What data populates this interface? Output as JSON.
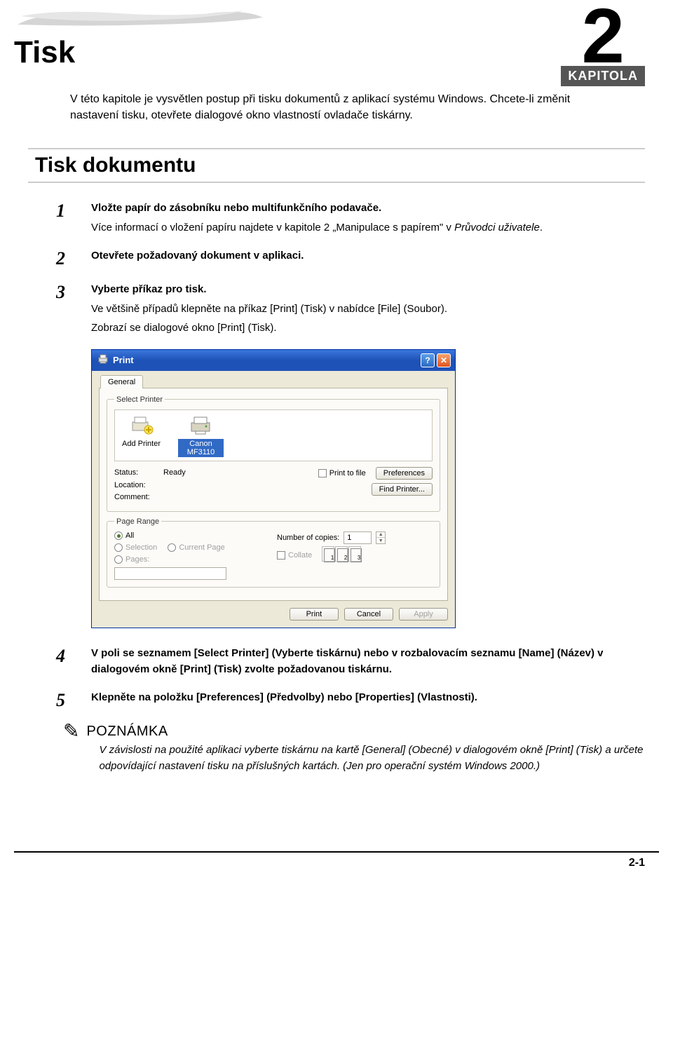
{
  "chapter": {
    "number": "2",
    "label": "KAPITOLA"
  },
  "title": "Tisk",
  "intro": "V této kapitole je vysvětlen postup při tisku dokumentů z aplikací systému Windows. Chcete-li změnit nastavení tisku, otevřete dialogové okno vlastností ovladače tiskárny.",
  "section_heading": "Tisk dokumentu",
  "steps": [
    {
      "num": "1",
      "bold": "Vložte papír do zásobníku nebo multifunkčního podavače.",
      "second_pre": "Více informací o vložení papíru najdete v kapitole 2 „Manipulace s papírem\" v ",
      "second_em": "Průvodci uživatele",
      "second_post": "."
    },
    {
      "num": "2",
      "bold": "Otevřete požadovaný dokument v aplikaci."
    },
    {
      "num": "3",
      "bold": "Vyberte příkaz pro tisk.",
      "second": "Ve většině případů klepněte na příkaz [Print] (Tisk) v nabídce [File] (Soubor).",
      "third": "Zobrazí se dialogové okno [Print] (Tisk)."
    },
    {
      "num": "4",
      "bold": "V poli se seznamem [Select Printer] (Vyberte tiskárnu) nebo v rozbalovacím seznamu [Name] (Název) v dialogovém okně [Print] (Tisk) zvolte požadovanou tiskárnu."
    },
    {
      "num": "5",
      "bold": "Klepněte na položku [Preferences] (Předvolby) nebo [Properties] (Vlastnosti)."
    }
  ],
  "dialog": {
    "title": "Print",
    "tab": "General",
    "group_select": "Select Printer",
    "printers": {
      "add": "Add Printer",
      "selected": "Canon MF3110"
    },
    "status": {
      "status_lbl": "Status:",
      "status_val": "Ready",
      "location_lbl": "Location:",
      "comment_lbl": "Comment:",
      "print_to_file": "Print to file",
      "preferences": "Preferences",
      "find_printer": "Find Printer..."
    },
    "range": {
      "legend": "Page Range",
      "all": "All",
      "selection": "Selection",
      "current": "Current Page",
      "pages": "Pages:",
      "copies_lbl": "Number of copies:",
      "copies_val": "1",
      "collate": "Collate",
      "p1": "1",
      "p2": "2",
      "p3": "3"
    },
    "buttons": {
      "print": "Print",
      "cancel": "Cancel",
      "apply": "Apply"
    }
  },
  "note": {
    "title": "POZNÁMKA",
    "text": "V závislosti na použité aplikaci vyberte tiskárnu na kartě [General] (Obecné) v dialogovém okně [Print] (Tisk) a určete odpovídající nastavení tisku na příslušných kartách. (Jen pro operační systém Windows 2000.)"
  },
  "page_number": "2-1"
}
